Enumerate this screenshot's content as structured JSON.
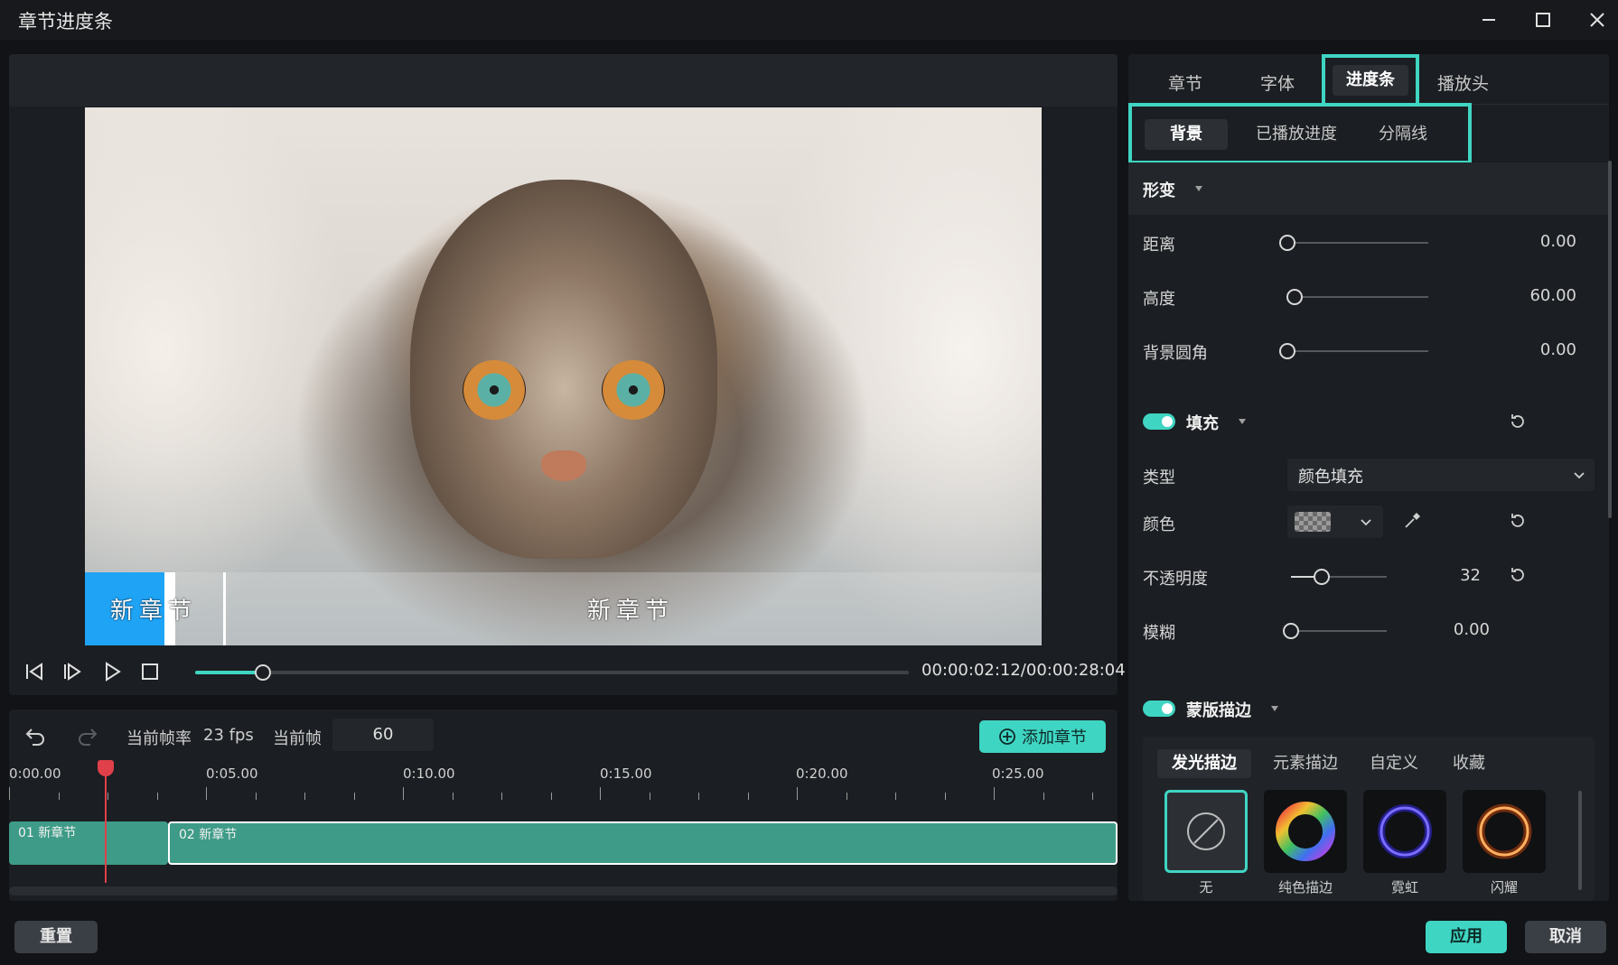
{
  "window": {
    "title": "章节进度条"
  },
  "player": {
    "timecode": "00:00:02:12/00:00:28:04",
    "progress": 0.095
  },
  "video": {
    "chapter_labels": [
      "新章节",
      "新章节"
    ]
  },
  "timeline": {
    "frame_rate_label": "当前帧率",
    "frame_rate_value": "23 fps",
    "current_frame_label": "当前帧",
    "current_frame_value": "60",
    "add_chapter_label": "添加章节",
    "ruler": [
      "0:00.00",
      "0:05.00",
      "0:10.00",
      "0:15.00",
      "0:20.00",
      "0:25.00"
    ],
    "clips": [
      {
        "label": "01 新章节"
      },
      {
        "label": "02 新章节"
      }
    ]
  },
  "panel": {
    "main_tabs": [
      "章节",
      "字体",
      "进度条",
      "播放头"
    ],
    "sub_tabs": [
      "背景",
      "已播放进度",
      "分隔线"
    ],
    "transform": {
      "title": "形变",
      "rows": [
        {
          "label": "距离",
          "value": "0.00",
          "level": 0.0
        },
        {
          "label": "高度",
          "value": "60.00",
          "level": 0.05
        },
        {
          "label": "背景圆角",
          "value": "0.00",
          "level": 0.0
        }
      ]
    },
    "fill": {
      "title": "填充",
      "type_label": "类型",
      "type_value": "颜色填充",
      "color_label": "颜色",
      "opacity_label": "不透明度",
      "opacity_value": "32",
      "opacity_level": 0.32,
      "blur_label": "模糊",
      "blur_value": "0.00",
      "blur_level": 0.0
    },
    "mask_stroke": {
      "title": "蒙版描边",
      "tabs": [
        "发光描边",
        "元素描边",
        "自定义",
        "收藏"
      ],
      "presets": [
        "无",
        "纯色描边",
        "霓虹",
        "闪耀"
      ]
    }
  },
  "buttons": {
    "reset": "重置",
    "apply": "应用",
    "cancel": "取消"
  },
  "colors": {
    "accent": "#3fd5c3",
    "clip": "#3e9b87",
    "playhead": "#e0404a",
    "chapter_played": "#1fa3f5"
  }
}
